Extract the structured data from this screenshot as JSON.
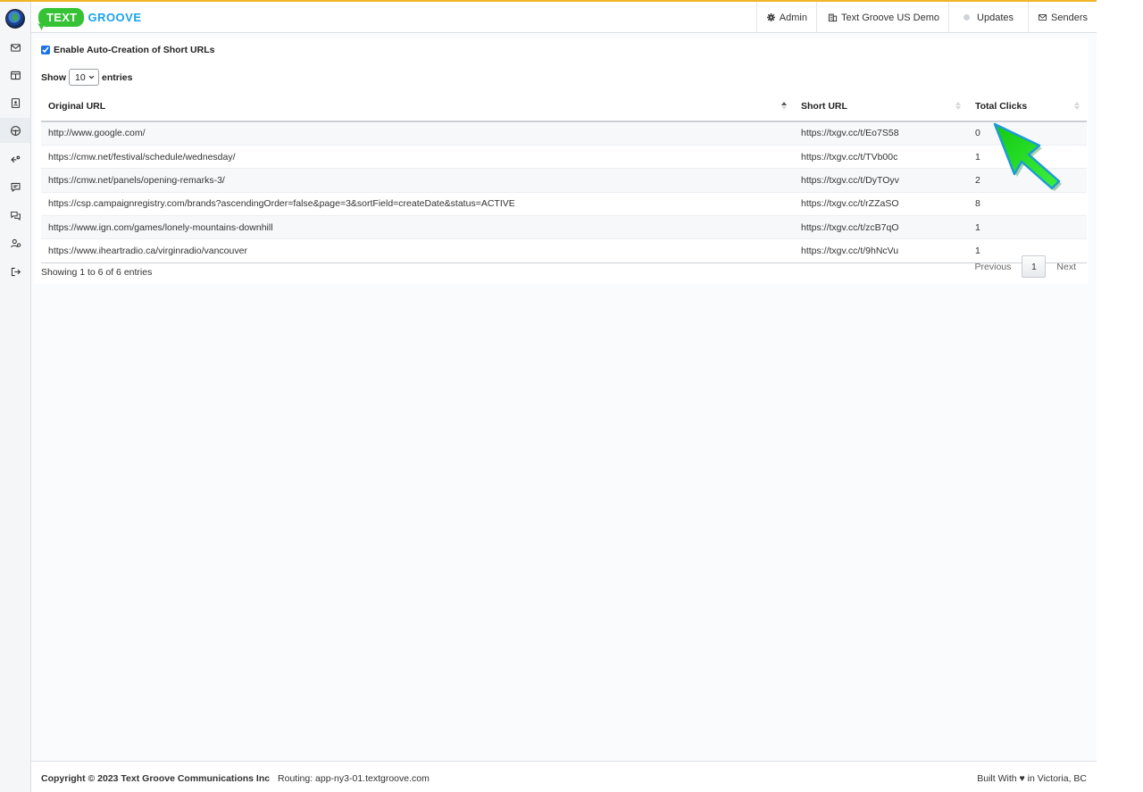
{
  "brand": {
    "pill_text": "TEXT",
    "word": "GROOVE"
  },
  "header_nav": [
    {
      "label": "Admin",
      "icon": "gear-icon"
    },
    {
      "label": "Text Groove US Demo",
      "icon": "building-icon"
    },
    {
      "label": "Updates",
      "icon": "status-dot-icon"
    },
    {
      "label": "Senders",
      "icon": "envelope-icon"
    }
  ],
  "sidebar": {
    "items": [
      {
        "name": "inbox",
        "icon": "envelope-icon"
      },
      {
        "name": "dashboard",
        "icon": "columns-icon"
      },
      {
        "name": "contacts",
        "icon": "contact-card-icon"
      },
      {
        "name": "campaigns",
        "icon": "steering-icon"
      },
      {
        "name": "short-urls",
        "icon": "link-share-icon"
      },
      {
        "name": "messages",
        "icon": "message-icon"
      },
      {
        "name": "conversations",
        "icon": "chat-icon"
      },
      {
        "name": "users",
        "icon": "user-settings-icon"
      },
      {
        "name": "logout",
        "icon": "logout-icon"
      }
    ]
  },
  "settings": {
    "auto_create_label": "Enable Auto-Creation of Short URLs",
    "auto_create_checked": true
  },
  "length_menu": {
    "show": "Show",
    "value": "10",
    "entries": "entries"
  },
  "table": {
    "columns": [
      "Original URL",
      "Short URL",
      "Total Clicks"
    ],
    "rows": [
      {
        "original": "http://www.google.com/",
        "short": "https://txgv.cc/t/Eo7S58",
        "clicks": "0"
      },
      {
        "original": "https://cmw.net/festival/schedule/wednesday/",
        "short": "https://txgv.cc/t/TVb00c",
        "clicks": "1"
      },
      {
        "original": "https://cmw.net/panels/opening-remarks-3/",
        "short": "https://txgv.cc/t/DyTOyv",
        "clicks": "2"
      },
      {
        "original": "https://csp.campaignregistry.com/brands?ascendingOrder=false&page=3&sortField=createDate&status=ACTIVE",
        "short": "https://txgv.cc/t/rZZaSO",
        "clicks": "8"
      },
      {
        "original": "https://www.ign.com/games/lonely-mountains-downhill",
        "short": "https://txgv.cc/t/zcB7qO",
        "clicks": "1"
      },
      {
        "original": "https://www.iheartradio.ca/virginradio/vancouver",
        "short": "https://txgv.cc/t/9hNcVu",
        "clicks": "1"
      }
    ]
  },
  "table_info": "Showing 1 to 6 of 6 entries",
  "pagination": {
    "previous": "Previous",
    "current": "1",
    "next": "Next"
  },
  "footer": {
    "copyright": "Copyright © 2023 Text Groove Communications Inc",
    "routing": "Routing: app-ny3-01.textgroove.com",
    "built_with": "Built With ♥ in Victoria, BC"
  },
  "colors": {
    "brand_green": "#35c335",
    "brand_blue": "#1aa3e8",
    "pointer_green": "#22dd22",
    "top_rule": "#f0b429"
  }
}
